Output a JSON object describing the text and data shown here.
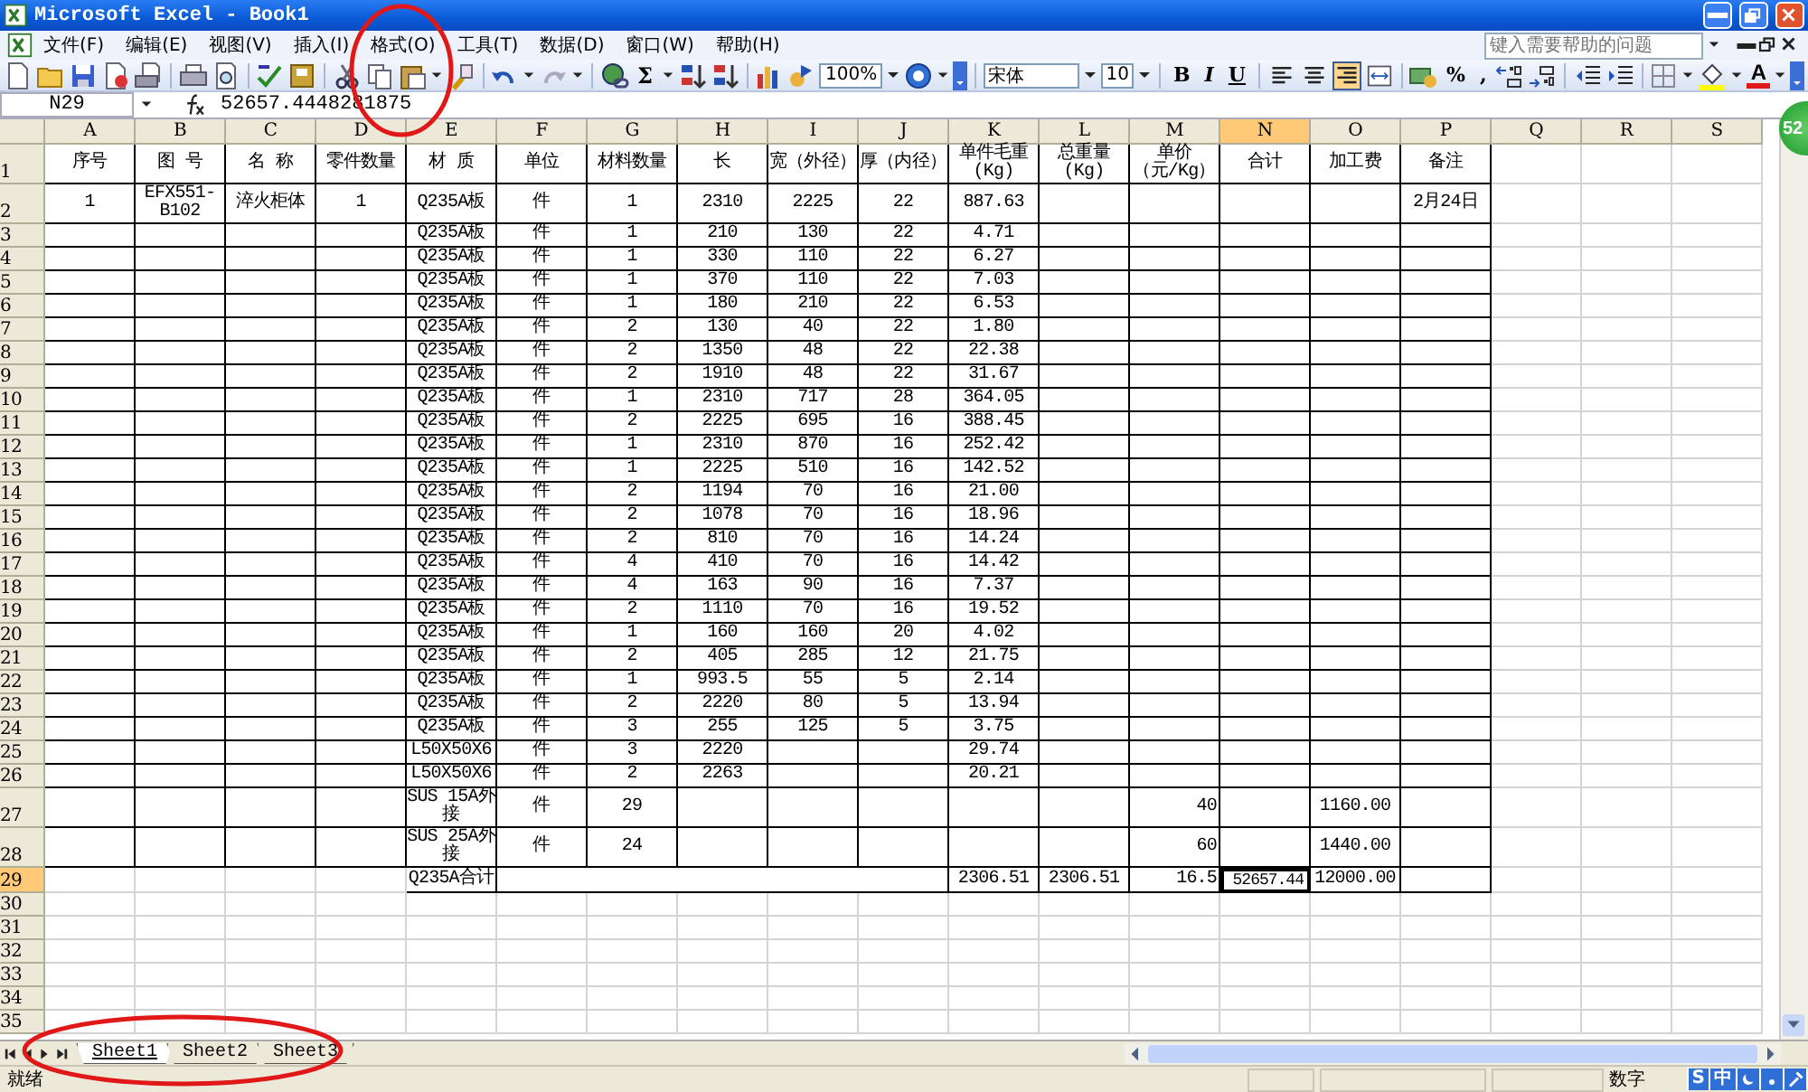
{
  "window": {
    "title": "Microsoft Excel - Book1"
  },
  "menu": [
    {
      "label": "文件(F)",
      "circled": false
    },
    {
      "label": "编辑(E)",
      "circled": false
    },
    {
      "label": "视图(V)",
      "circled": false
    },
    {
      "label": "插入(I)",
      "circled": false
    },
    {
      "label": "格式(O)",
      "circled": true
    },
    {
      "label": "工具(T)",
      "circled": false
    },
    {
      "label": "数据(D)",
      "circled": false
    },
    {
      "label": "窗口(W)",
      "circled": false
    },
    {
      "label": "帮助(H)",
      "circled": false
    }
  ],
  "help_search": {
    "placeholder": "键入需要帮助的问题"
  },
  "standard_toolbar": {
    "autosum": "Σ",
    "zoom": "100%"
  },
  "formatting_toolbar": {
    "font": "宋体",
    "size": "10",
    "style_buttons": [
      {
        "label": "B",
        "kind": "bold"
      },
      {
        "label": "I",
        "kind": "italic"
      },
      {
        "label": "U",
        "kind": "underline"
      }
    ],
    "alignment": [
      {
        "kind": "left",
        "selected": false
      },
      {
        "kind": "center",
        "selected": false
      },
      {
        "kind": "right",
        "selected": true
      },
      {
        "kind": "merge",
        "selected": false
      }
    ],
    "number_buttons": [
      "%",
      ","
    ],
    "font_color_button": "A"
  },
  "formula_bar": {
    "name_box": "N29",
    "value": "52657.4448281875"
  },
  "columns": [
    {
      "label": "A",
      "selected": false
    },
    {
      "label": "B",
      "selected": false
    },
    {
      "label": "C",
      "selected": false
    },
    {
      "label": "D",
      "selected": false
    },
    {
      "label": "E",
      "selected": false
    },
    {
      "label": "F",
      "selected": false
    },
    {
      "label": "G",
      "selected": false
    },
    {
      "label": "H",
      "selected": false
    },
    {
      "label": "I",
      "selected": false
    },
    {
      "label": "J",
      "selected": false
    },
    {
      "label": "K",
      "selected": false
    },
    {
      "label": "L",
      "selected": false
    },
    {
      "label": "M",
      "selected": false
    },
    {
      "label": "N",
      "selected": true
    },
    {
      "label": "O",
      "selected": false
    },
    {
      "label": "P",
      "selected": false
    },
    {
      "label": "Q",
      "selected": false
    },
    {
      "label": "R",
      "selected": false
    },
    {
      "label": "S",
      "selected": false
    }
  ],
  "rows": [
    {
      "row": "1",
      "kind": "header",
      "selected": false,
      "cells": {
        "A": "序号",
        "B": "图 号",
        "C": "名 称",
        "D": "零件数量",
        "E": "材 质",
        "F": "单位",
        "G": "材料数量",
        "H": "长",
        "I": "宽（外径）",
        "J": "厚（内径）",
        "K": "单件毛重(Kg)",
        "L": "总重量(Kg)",
        "M": "单价（元/Kg）",
        "N": "合计",
        "O": "加工费",
        "P": "备注"
      }
    },
    {
      "row": "2",
      "kind": "data",
      "selected": false,
      "cells": {
        "A": "1",
        "B": "EFX551-B102",
        "C": "淬火柜体",
        "D": "1",
        "E": "Q235A板",
        "F": "件",
        "G": "1",
        "H": "2310",
        "I": "2225",
        "J": "22",
        "K": "887.63",
        "P": "2月24日"
      }
    },
    {
      "row": "3",
      "kind": "data",
      "selected": false,
      "cells": {
        "E": "Q235A板",
        "F": "件",
        "G": "1",
        "H": "210",
        "I": "130",
        "J": "22",
        "K": "4.71"
      }
    },
    {
      "row": "4",
      "kind": "data",
      "selected": false,
      "cells": {
        "E": "Q235A板",
        "F": "件",
        "G": "1",
        "H": "330",
        "I": "110",
        "J": "22",
        "K": "6.27"
      }
    },
    {
      "row": "5",
      "kind": "data",
      "selected": false,
      "cells": {
        "E": "Q235A板",
        "F": "件",
        "G": "1",
        "H": "370",
        "I": "110",
        "J": "22",
        "K": "7.03"
      }
    },
    {
      "row": "6",
      "kind": "data",
      "selected": false,
      "cells": {
        "E": "Q235A板",
        "F": "件",
        "G": "1",
        "H": "180",
        "I": "210",
        "J": "22",
        "K": "6.53"
      }
    },
    {
      "row": "7",
      "kind": "data",
      "selected": false,
      "cells": {
        "E": "Q235A板",
        "F": "件",
        "G": "2",
        "H": "130",
        "I": "40",
        "J": "22",
        "K": "1.80"
      }
    },
    {
      "row": "8",
      "kind": "data",
      "selected": false,
      "cells": {
        "E": "Q235A板",
        "F": "件",
        "G": "2",
        "H": "1350",
        "I": "48",
        "J": "22",
        "K": "22.38"
      }
    },
    {
      "row": "9",
      "kind": "data",
      "selected": false,
      "cells": {
        "E": "Q235A板",
        "F": "件",
        "G": "2",
        "H": "1910",
        "I": "48",
        "J": "22",
        "K": "31.67"
      }
    },
    {
      "row": "10",
      "kind": "data",
      "selected": false,
      "cells": {
        "E": "Q235A板",
        "F": "件",
        "G": "1",
        "H": "2310",
        "I": "717",
        "J": "28",
        "K": "364.05"
      }
    },
    {
      "row": "11",
      "kind": "data",
      "selected": false,
      "cells": {
        "E": "Q235A板",
        "F": "件",
        "G": "2",
        "H": "2225",
        "I": "695",
        "J": "16",
        "K": "388.45"
      }
    },
    {
      "row": "12",
      "kind": "data",
      "selected": false,
      "cells": {
        "E": "Q235A板",
        "F": "件",
        "G": "1",
        "H": "2310",
        "I": "870",
        "J": "16",
        "K": "252.42"
      }
    },
    {
      "row": "13",
      "kind": "data",
      "selected": false,
      "cells": {
        "E": "Q235A板",
        "F": "件",
        "G": "1",
        "H": "2225",
        "I": "510",
        "J": "16",
        "K": "142.52"
      }
    },
    {
      "row": "14",
      "kind": "data",
      "selected": false,
      "cells": {
        "E": "Q235A板",
        "F": "件",
        "G": "2",
        "H": "1194",
        "I": "70",
        "J": "16",
        "K": "21.00"
      }
    },
    {
      "row": "15",
      "kind": "data",
      "selected": false,
      "cells": {
        "E": "Q235A板",
        "F": "件",
        "G": "2",
        "H": "1078",
        "I": "70",
        "J": "16",
        "K": "18.96"
      }
    },
    {
      "row": "16",
      "kind": "data",
      "selected": false,
      "cells": {
        "E": "Q235A板",
        "F": "件",
        "G": "2",
        "H": "810",
        "I": "70",
        "J": "16",
        "K": "14.24"
      }
    },
    {
      "row": "17",
      "kind": "data",
      "selected": false,
      "cells": {
        "E": "Q235A板",
        "F": "件",
        "G": "4",
        "H": "410",
        "I": "70",
        "J": "16",
        "K": "14.42"
      }
    },
    {
      "row": "18",
      "kind": "data",
      "selected": false,
      "cells": {
        "E": "Q235A板",
        "F": "件",
        "G": "4",
        "H": "163",
        "I": "90",
        "J": "16",
        "K": "7.37"
      }
    },
    {
      "row": "19",
      "kind": "data",
      "selected": false,
      "cells": {
        "E": "Q235A板",
        "F": "件",
        "G": "2",
        "H": "1110",
        "I": "70",
        "J": "16",
        "K": "19.52"
      }
    },
    {
      "row": "20",
      "kind": "data",
      "selected": false,
      "cells": {
        "E": "Q235A板",
        "F": "件",
        "G": "1",
        "H": "160",
        "I": "160",
        "J": "20",
        "K": "4.02"
      }
    },
    {
      "row": "21",
      "kind": "data",
      "selected": false,
      "cells": {
        "E": "Q235A板",
        "F": "件",
        "G": "2",
        "H": "405",
        "I": "285",
        "J": "12",
        "K": "21.75"
      }
    },
    {
      "row": "22",
      "kind": "data",
      "selected": false,
      "cells": {
        "E": "Q235A板",
        "F": "件",
        "G": "1",
        "H": "993.5",
        "I": "55",
        "J": "5",
        "K": "2.14"
      }
    },
    {
      "row": "23",
      "kind": "data",
      "selected": false,
      "cells": {
        "E": "Q235A板",
        "F": "件",
        "G": "2",
        "H": "2220",
        "I": "80",
        "J": "5",
        "K": "13.94"
      }
    },
    {
      "row": "24",
      "kind": "data",
      "selected": false,
      "cells": {
        "E": "Q235A板",
        "F": "件",
        "G": "3",
        "H": "255",
        "I": "125",
        "J": "5",
        "K": "3.75"
      }
    },
    {
      "row": "25",
      "kind": "data",
      "selected": false,
      "cells": {
        "E": "L50X50X6",
        "F": "件",
        "G": "3",
        "H": "2220",
        "K": "29.74"
      }
    },
    {
      "row": "26",
      "kind": "data",
      "selected": false,
      "cells": {
        "E": "L50X50X6",
        "F": "件",
        "G": "2",
        "H": "2263",
        "K": "20.21"
      }
    },
    {
      "row": "27",
      "kind": "data",
      "selected": false,
      "cells": {
        "E": "SUS 15A外接",
        "F": "件",
        "G": "29",
        "M": "40",
        "O": "1160.00"
      }
    },
    {
      "row": "28",
      "kind": "data",
      "selected": false,
      "cells": {
        "E": "SUS 25A外接",
        "F": "件",
        "G": "24",
        "M": "60",
        "O": "1440.00"
      }
    },
    {
      "row": "29",
      "kind": "total",
      "selected": true,
      "cells": {
        "E": "Q235A合计",
        "K": "2306.51",
        "L": "2306.51",
        "M": "16.5",
        "N": "52657.44",
        "O": "12000.00"
      }
    },
    {
      "row": "30",
      "kind": "blank",
      "selected": false
    },
    {
      "row": "31",
      "kind": "blank",
      "selected": false
    },
    {
      "row": "32",
      "kind": "blank",
      "selected": false
    },
    {
      "row": "33",
      "kind": "blank",
      "selected": false
    },
    {
      "row": "34",
      "kind": "blank",
      "selected": false
    },
    {
      "row": "35",
      "kind": "blank",
      "selected": false
    }
  ],
  "sheet_tabs": {
    "circled": true,
    "tabs": [
      {
        "label": "Sheet1",
        "selected": true
      },
      {
        "label": "Sheet2",
        "selected": false
      },
      {
        "label": "Sheet3",
        "selected": false
      }
    ]
  },
  "status_bar": {
    "status": "就绪",
    "mode": "数字",
    "ime": [
      "S",
      "中"
    ]
  },
  "floating_badge": "52"
}
